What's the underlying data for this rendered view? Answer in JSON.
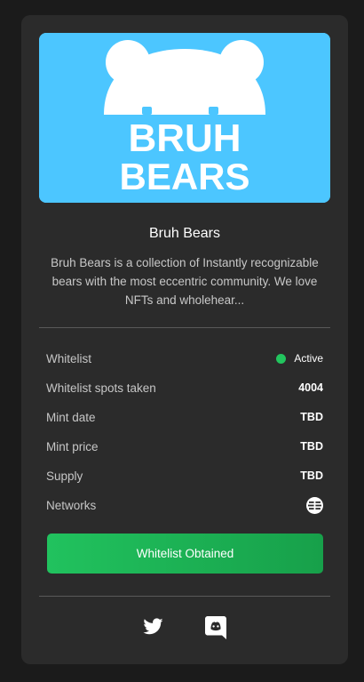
{
  "logo": {
    "line1": "BRUH",
    "line2": "BEARS",
    "bg_color": "#4cc6ff"
  },
  "project": {
    "title": "Bruh Bears",
    "description": "Bruh Bears is a collection of Instantly recognizable bears with the most eccentric community. We love NFTs and wholehear..."
  },
  "details": {
    "whitelist": {
      "label": "Whitelist",
      "value": "Active",
      "status_color": "#22c55e"
    },
    "spots": {
      "label": "Whitelist spots taken",
      "value": "4004"
    },
    "mint_date": {
      "label": "Mint date",
      "value": "TBD"
    },
    "mint_price": {
      "label": "Mint price",
      "value": "TBD"
    },
    "supply": {
      "label": "Supply",
      "value": "TBD"
    },
    "networks": {
      "label": "Networks",
      "icon": "network-icon"
    }
  },
  "cta": {
    "label": "Whitelist Obtained",
    "color": "#21c25e"
  },
  "social": {
    "twitter_icon": "twitter-icon",
    "discord_icon": "discord-icon"
  }
}
